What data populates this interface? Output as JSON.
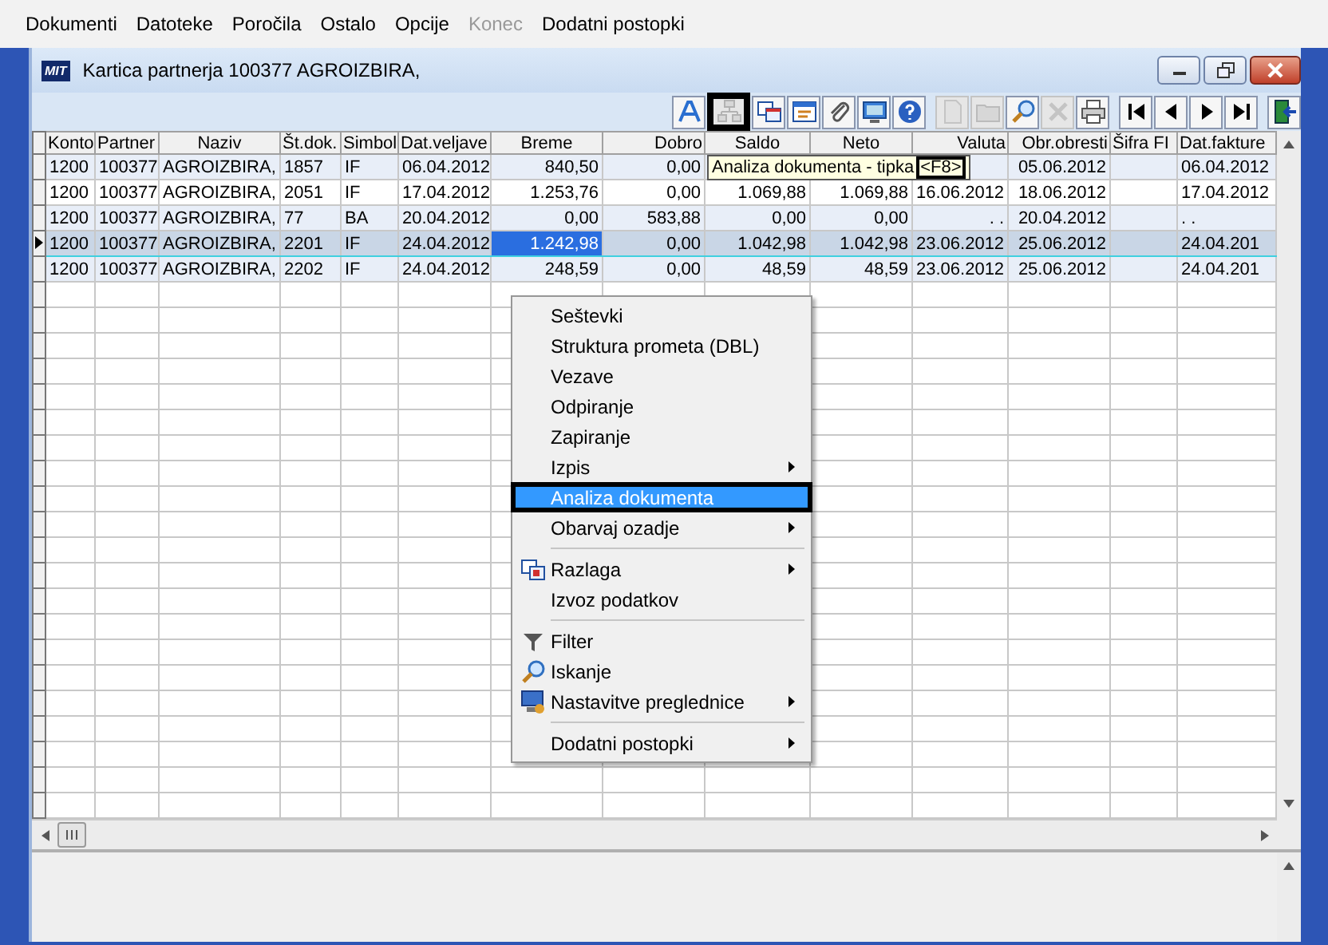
{
  "menubar": [
    {
      "label": "Dokumenti",
      "disabled": false
    },
    {
      "label": "Datoteke",
      "disabled": false
    },
    {
      "label": "Poročila",
      "disabled": false
    },
    {
      "label": "Ostalo",
      "disabled": false
    },
    {
      "label": "Opcije",
      "disabled": false
    },
    {
      "label": "Konec",
      "disabled": true
    },
    {
      "label": "Dodatni postopki",
      "disabled": false
    }
  ],
  "window": {
    "title": "Kartica partnerja 100377 AGROIZBIRA,",
    "logo": "MIT"
  },
  "toolbar": [
    [
      {
        "kind": "letter",
        "disabled": false,
        "highlighted": false
      },
      {
        "kind": "tree",
        "disabled": true,
        "highlighted": true
      },
      {
        "kind": "windows",
        "disabled": false,
        "highlighted": false
      },
      {
        "kind": "list",
        "disabled": false,
        "highlighted": false
      },
      {
        "kind": "clip",
        "disabled": false,
        "highlighted": false
      },
      {
        "kind": "monitor",
        "disabled": false,
        "highlighted": false
      },
      {
        "kind": "help",
        "disabled": false,
        "highlighted": false
      }
    ],
    [
      {
        "kind": "page",
        "disabled": true,
        "highlighted": false
      },
      {
        "kind": "folder",
        "disabled": true,
        "highlighted": false
      },
      {
        "kind": "search",
        "disabled": false,
        "highlighted": false
      },
      {
        "kind": "cross",
        "disabled": true,
        "highlighted": false
      },
      {
        "kind": "print",
        "disabled": false,
        "highlighted": false
      }
    ],
    [
      {
        "kind": "first",
        "disabled": false,
        "highlighted": false
      },
      {
        "kind": "prev",
        "disabled": false,
        "highlighted": false
      },
      {
        "kind": "next",
        "disabled": false,
        "highlighted": false
      },
      {
        "kind": "last",
        "disabled": false,
        "highlighted": false
      }
    ],
    [
      {
        "kind": "exit",
        "disabled": false,
        "highlighted": false
      }
    ]
  ],
  "table": {
    "columns": [
      "Konto",
      "Partner",
      "Naziv",
      "Št.dok.",
      "Simbol",
      "Dat.veljave",
      "Breme",
      "Dobro",
      "Saldo",
      "Neto",
      "Valuta",
      "Obr.obresti",
      "Šifra FI",
      "Dat.fakture"
    ],
    "rows": [
      {
        "selected": false,
        "cells": [
          "1200",
          "100377",
          "AGROIZBIRA,",
          "1857",
          "IF",
          "06.04.2012",
          "840,50",
          "0,00",
          null,
          null,
          null,
          "05.06.2012",
          null,
          "06.04.2012"
        ]
      },
      {
        "selected": false,
        "cells": [
          "1200",
          "100377",
          "AGROIZBIRA,",
          "2051",
          "IF",
          "17.04.2012",
          "1.253,76",
          "0,00",
          "1.069,88",
          "1.069,88",
          "16.06.2012",
          "18.06.2012",
          null,
          "17.04.2012"
        ]
      },
      {
        "selected": false,
        "cells": [
          "1200",
          "100377",
          "AGROIZBIRA,",
          "77",
          "BA",
          "20.04.2012",
          "0,00",
          "583,88",
          "0,00",
          "0,00",
          ". .",
          "20.04.2012",
          null,
          ". ."
        ]
      },
      {
        "selected": true,
        "cells": [
          "1200",
          "100377",
          "AGROIZBIRA,",
          "2201",
          "IF",
          "24.04.2012",
          {
            "text": "1.242,98",
            "focused": true
          },
          "0,00",
          "1.042,98",
          "1.042,98",
          "23.06.2012",
          "25.06.2012",
          null,
          "24.04.201"
        ]
      },
      {
        "selected": false,
        "cells": [
          "1200",
          "100377",
          "AGROIZBIRA,",
          "2202",
          "IF",
          "24.04.2012",
          "248,59",
          "0,00",
          "48,59",
          "48,59",
          "23.06.2012",
          "25.06.2012",
          null,
          "24.04.201"
        ]
      }
    ]
  },
  "tooltip": {
    "text": "Analiza dokumenta - tipka",
    "key": "<F8>",
    "key_highlighted": true
  },
  "context_menu": [
    {
      "kind": "item",
      "label": "Seštevki",
      "selected": false,
      "submenu": false
    },
    {
      "kind": "item",
      "label": "Struktura prometa (DBL)",
      "selected": false,
      "submenu": false
    },
    {
      "kind": "item",
      "label": "Vezave",
      "selected": false,
      "submenu": false
    },
    {
      "kind": "item",
      "label": "Odpiranje",
      "selected": false,
      "submenu": false
    },
    {
      "kind": "item",
      "label": "Zapiranje",
      "selected": false,
      "submenu": false
    },
    {
      "kind": "item",
      "label": "Izpis",
      "selected": false,
      "submenu": true
    },
    {
      "kind": "item",
      "label": "Analiza dokumenta",
      "selected": true,
      "submenu": false,
      "highlighted": true
    },
    {
      "kind": "item",
      "label": "Obarvaj ozadje",
      "selected": false,
      "submenu": true
    },
    {
      "kind": "separator"
    },
    {
      "kind": "item",
      "label": "Razlaga",
      "selected": false,
      "submenu": true,
      "icon": {
        "kind": "windows"
      }
    },
    {
      "kind": "item",
      "label": "Izvoz podatkov",
      "selected": false,
      "submenu": false
    },
    {
      "kind": "separator"
    },
    {
      "kind": "item",
      "label": "Filter",
      "selected": false,
      "submenu": false,
      "icon": {
        "kind": "filter"
      }
    },
    {
      "kind": "item",
      "label": "Iskanje",
      "selected": false,
      "submenu": false,
      "icon": {
        "kind": "search"
      }
    },
    {
      "kind": "item",
      "label": "Nastavitve preglednice",
      "selected": false,
      "submenu": true,
      "icon": {
        "kind": "monitor"
      }
    },
    {
      "kind": "separator"
    },
    {
      "kind": "item",
      "label": "Dodatni postopki",
      "selected": false,
      "submenu": true
    }
  ]
}
